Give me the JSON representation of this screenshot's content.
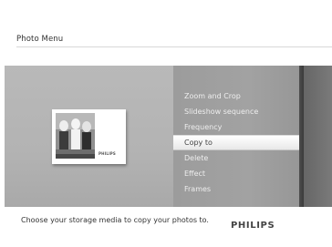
{
  "header": {
    "title": "Photo Menu"
  },
  "preview": {
    "brand_label": "PHILIPS"
  },
  "menu": {
    "items": [
      {
        "label": "Zoom and Crop"
      },
      {
        "label": "Slideshow sequence"
      },
      {
        "label": "Frequency"
      },
      {
        "label": "Copy to"
      },
      {
        "label": "Delete"
      },
      {
        "label": "Effect"
      },
      {
        "label": "Frames"
      }
    ],
    "selected_index": 3
  },
  "footer": {
    "hint": "Choose your storage media to copy your photos to.",
    "brand": "PHILIPS"
  },
  "colors": {
    "selected_bg": "#ffffff",
    "menu_text": "#eeeeee",
    "panel_bg": "#b3b3b3",
    "menu_bg": "#a2a2a2"
  }
}
